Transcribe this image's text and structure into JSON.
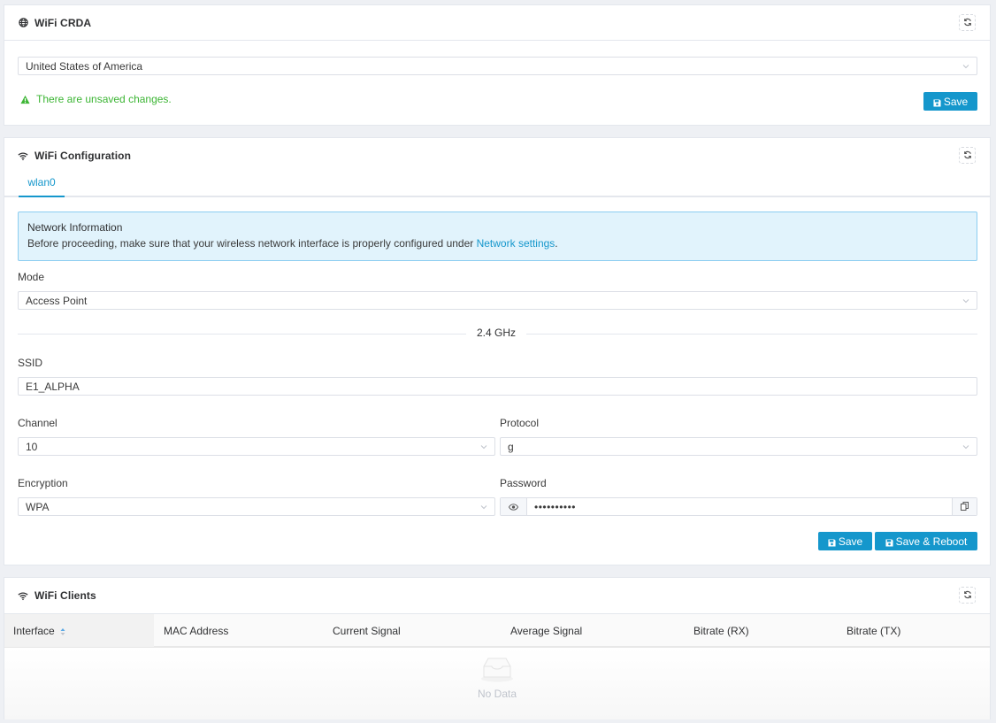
{
  "crda": {
    "title": "WiFi CRDA",
    "title_icon": "globe-icon",
    "country_select": {
      "value": "United States of America"
    },
    "warning": "There are unsaved changes.",
    "save_label": "Save",
    "colors": {
      "warning": "#3cb534",
      "primary": "#1597cc"
    }
  },
  "config": {
    "title": "WiFi Configuration",
    "title_icon": "wifi-icon",
    "tabs": [
      {
        "label": "wlan0",
        "active": true
      }
    ],
    "info": {
      "title": "Network Information",
      "text_before": "Before proceeding, make sure that your wireless network interface is properly configured under ",
      "link": "Network settings",
      "text_after": "."
    },
    "mode": {
      "label": "Mode",
      "value": "Access Point"
    },
    "band_label": "2.4 GHz",
    "ssid": {
      "label": "SSID",
      "value": "E1_ALPHA"
    },
    "channel": {
      "label": "Channel",
      "value": "10"
    },
    "protocol": {
      "label": "Protocol",
      "value": "g"
    },
    "encryption": {
      "label": "Encryption",
      "value": "WPA"
    },
    "password": {
      "label": "Password",
      "value": "••••••••••"
    },
    "save_label": "Save",
    "save_reboot_label": "Save & Reboot"
  },
  "clients": {
    "title": "WiFi Clients",
    "title_icon": "wifi-icon",
    "columns": [
      "Interface",
      "MAC Address",
      "Current Signal",
      "Average Signal",
      "Bitrate (RX)",
      "Bitrate (TX)"
    ],
    "sorted_column": "Interface",
    "rows": [],
    "empty_text": "No Data"
  }
}
